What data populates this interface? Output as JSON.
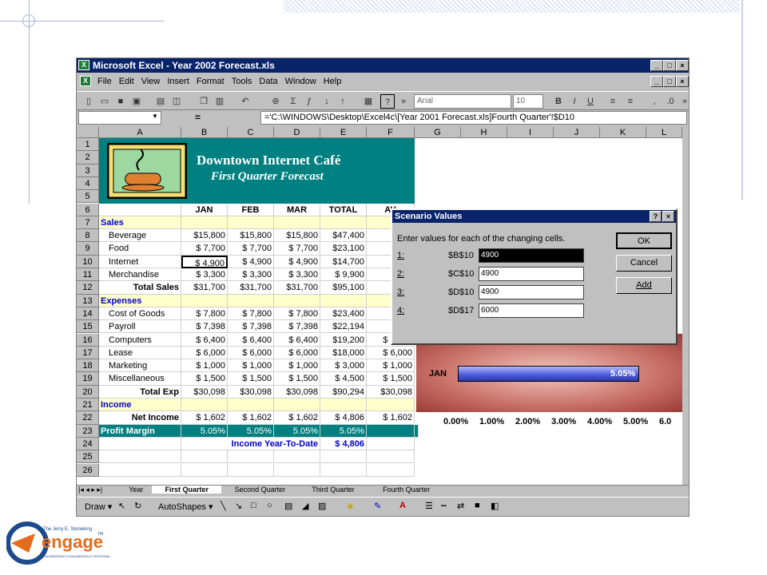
{
  "window": {
    "title": "Microsoft Excel - Year 2002 Forecast.xls",
    "min": "_",
    "max": "□",
    "close": "×"
  },
  "menu": [
    "File",
    "Edit",
    "View",
    "Insert",
    "Format",
    "Tools",
    "Data",
    "Window",
    "Help"
  ],
  "toolbar": {
    "font": "Arial",
    "size": "10",
    "bold": "B",
    "italic": "I",
    "underline": "U"
  },
  "formula": {
    "eq": "=",
    "text": "='C:\\WINDOWS\\Desktop\\Excel4c\\[Year 2001 Forecast.xls]Fourth Quarter'!$D10"
  },
  "columns": [
    "A",
    "B",
    "C",
    "D",
    "E",
    "F",
    "G",
    "H",
    "I",
    "J",
    "K",
    "L"
  ],
  "banner": {
    "title": "Downtown Internet Café",
    "subtitle": "First Quarter Forecast"
  },
  "rows": [
    {
      "n": "1"
    },
    {
      "n": "2"
    },
    {
      "n": "3"
    },
    {
      "n": "4"
    },
    {
      "n": "5"
    },
    {
      "n": "6",
      "a": "",
      "b": "JAN",
      "c": "FEB",
      "d": "MAR",
      "e": "TOTAL",
      "f": "AV"
    },
    {
      "n": "7",
      "a": "Sales",
      "section": true
    },
    {
      "n": "8",
      "a": "Beverage",
      "b": "$15,800",
      "c": "$15,800",
      "d": "$15,800",
      "e": "$47,400",
      "f": "$15"
    },
    {
      "n": "9",
      "a": "Food",
      "b": "$ 7,700",
      "c": "$ 7,700",
      "d": "$ 7,700",
      "e": "$23,100",
      "f": "$ 7"
    },
    {
      "n": "10",
      "a": "Internet",
      "b": "$ 4,900",
      "c": "$ 4,900",
      "d": "$ 4,900",
      "e": "$14,700",
      "f": "$ 4"
    },
    {
      "n": "11",
      "a": "Merchandise",
      "b": "$ 3,300",
      "c": "$ 3,300",
      "d": "$ 3,300",
      "e": "$ 9,900",
      "f": "$ 3"
    },
    {
      "n": "12",
      "a": "Total Sales",
      "bold": true,
      "b": "$31,700",
      "c": "$31,700",
      "d": "$31,700",
      "e": "$95,100",
      "f": "$31"
    },
    {
      "n": "13",
      "a": "Expenses",
      "section": true
    },
    {
      "n": "14",
      "a": "Cost of Goods",
      "b": "$ 7,800",
      "c": "$ 7,800",
      "d": "$ 7,800",
      "e": "$23,400",
      "f": "$ 7"
    },
    {
      "n": "15",
      "a": "Payroll",
      "b": "$ 7,398",
      "c": "$ 7,398",
      "d": "$ 7,398",
      "e": "$22,194",
      "f": "$ 7"
    },
    {
      "n": "16",
      "a": "Computers",
      "b": "$ 6,400",
      "c": "$ 6,400",
      "d": "$ 6,400",
      "e": "$19,200",
      "f": "$ 6,400"
    },
    {
      "n": "17",
      "a": "Lease",
      "b": "$ 6,000",
      "c": "$ 6,000",
      "d": "$ 6,000",
      "e": "$18,000",
      "f": "$ 6,000"
    },
    {
      "n": "18",
      "a": "Marketing",
      "b": "$ 1,000",
      "c": "$ 1,000",
      "d": "$ 1,000",
      "e": "$ 3,000",
      "f": "$ 1,000"
    },
    {
      "n": "19",
      "a": "Miscellaneous",
      "b": "$ 1,500",
      "c": "$ 1,500",
      "d": "$ 1,500",
      "e": "$ 4,500",
      "f": "$ 1,500"
    },
    {
      "n": "20",
      "a": "Total Exp",
      "bold": true,
      "b": "$30,098",
      "c": "$30,098",
      "d": "$30,098",
      "e": "$90,294",
      "f": "$30,098"
    },
    {
      "n": "21",
      "a": "Income",
      "section": true
    },
    {
      "n": "22",
      "a": "Net Income",
      "bold": true,
      "b": "$ 1,602",
      "c": "$ 1,602",
      "d": "$ 1,602",
      "e": "$ 4,806",
      "f": "$ 1,602"
    },
    {
      "n": "23",
      "a": "Profit Margin",
      "teal": true,
      "b": "5.05%",
      "c": "5.05%",
      "d": "5.05%",
      "e": "5.05%"
    },
    {
      "n": "24",
      "cd": "Income Year-To-Date",
      "e": "$ 4,806"
    },
    {
      "n": "25"
    },
    {
      "n": "26"
    }
  ],
  "sheet_tabs": [
    "Year",
    "First Quarter",
    "Second Quarter",
    "Third Quarter",
    "Fourth Quarter"
  ],
  "draw": {
    "draw": "Draw ▾",
    "autoshapes": "AutoShapes ▾"
  },
  "dialog": {
    "title": "Scenario Values",
    "help": "?",
    "close": "×",
    "prompt": "Enter values for each of the changing cells.",
    "fields": [
      {
        "idx": "1:",
        "ref": "$B$10",
        "val": "4900"
      },
      {
        "idx": "2:",
        "ref": "$C$10",
        "val": "4900"
      },
      {
        "idx": "3:",
        "ref": "$D$10",
        "val": "4900"
      },
      {
        "idx": "4:",
        "ref": "$D$17",
        "val": "6000"
      }
    ],
    "ok": "OK",
    "cancel": "Cancel",
    "add": "Add"
  },
  "chart_data": {
    "type": "bar",
    "categories": [
      "JAN"
    ],
    "values": [
      5.05
    ],
    "data_labels": [
      "5.05%"
    ],
    "ticks": [
      "0.00%",
      "1.00%",
      "2.00%",
      "3.00%",
      "4.00%",
      "5.00%",
      "6.0"
    ],
    "xlim": [
      0,
      6
    ]
  },
  "logo": {
    "line1": "The Jerry E. Stoneking",
    "brand": "engage",
    "tm": "TM",
    "line3": "ENGINEERING FUNDAMENTALS PROGRAM"
  }
}
